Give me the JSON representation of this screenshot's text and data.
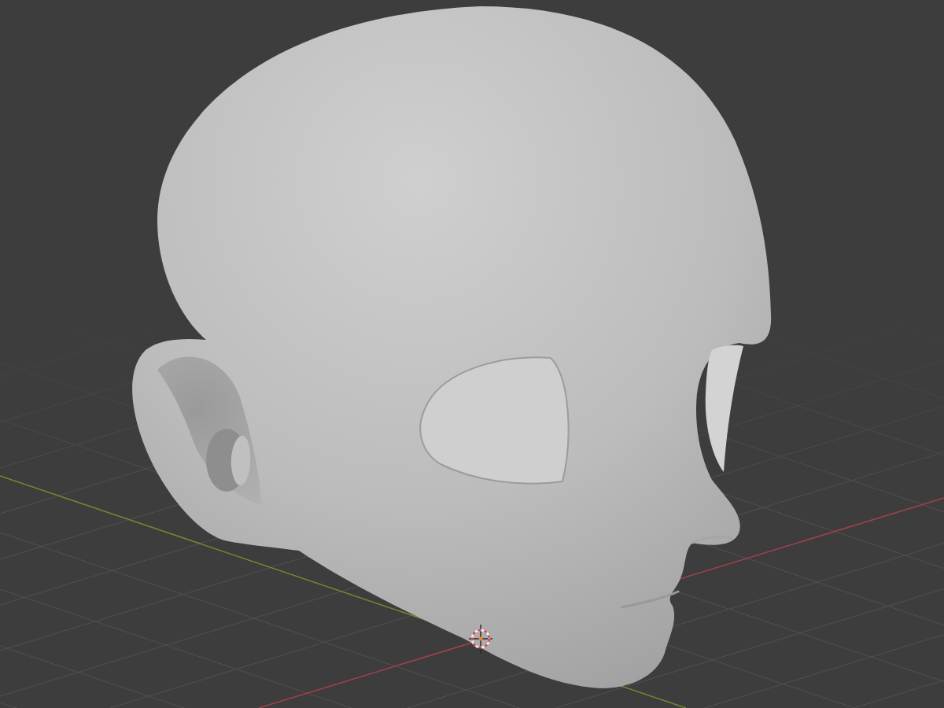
{
  "viewport": {
    "floor_grid": true,
    "cursor_3d": true,
    "axes": [
      {
        "kind": "x",
        "color": "#a3404e"
      },
      {
        "kind": "y",
        "color": "#718a2e"
      }
    ],
    "objects": [
      {
        "kind": "head"
      }
    ]
  }
}
